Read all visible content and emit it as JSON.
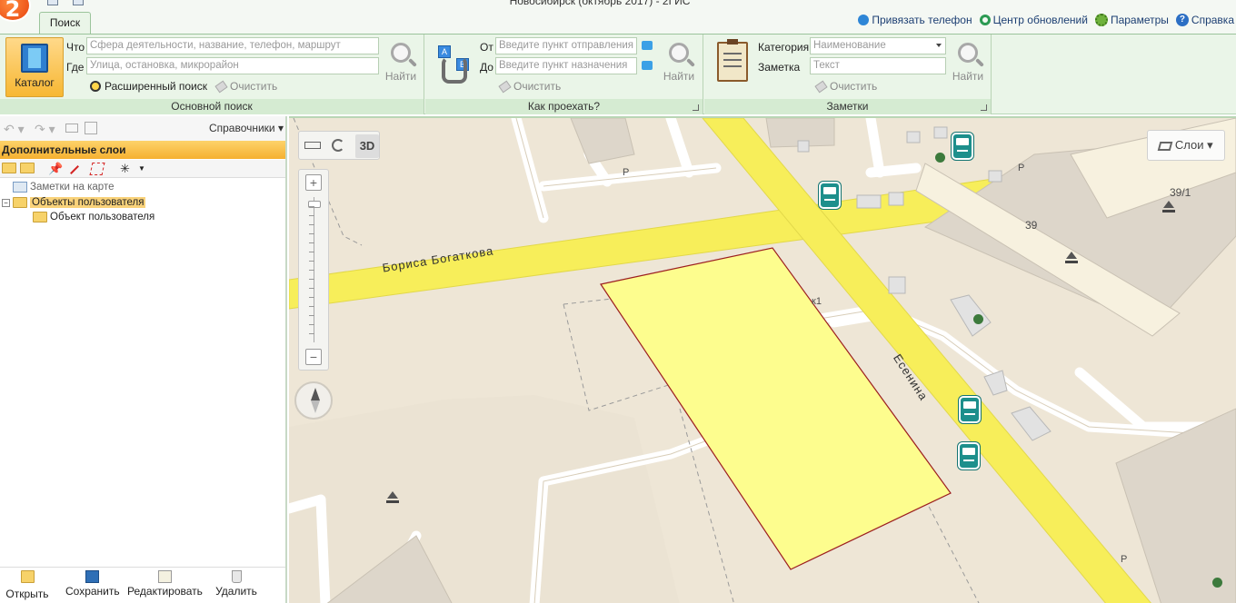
{
  "window": {
    "title": "Новосибирск (октябрь 2017) - 2ГИС",
    "logo_text": "2"
  },
  "tabs": [
    {
      "label": "Поиск"
    }
  ],
  "top_links": [
    {
      "label": "Привязать телефон",
      "icon": "phone-icon"
    },
    {
      "label": "Центр обновлений",
      "icon": "refresh-icon"
    },
    {
      "label": "Параметры",
      "icon": "gear-icon"
    },
    {
      "label": "Справка",
      "icon": "help-icon"
    }
  ],
  "ribbon": {
    "main_search": {
      "catalog_label": "Каталог",
      "what_label": "Что",
      "what_placeholder": "Сфера деятельности, название, телефон, маршрут",
      "where_label": "Где",
      "where_placeholder": "Улица, остановка, микрорайон",
      "search_label": "Найти",
      "advanced_label": "Расширенный поиск",
      "clear_label": "Очистить",
      "group_label": "Основной поиск"
    },
    "route": {
      "from_label": "От",
      "from_placeholder": "Введите пункт отправления",
      "to_label": "До",
      "to_placeholder": "Введите пункт назначения",
      "search_label": "Найти",
      "clear_label": "Очистить",
      "group_label": "Как проехать?"
    },
    "notes": {
      "category_label": "Категория",
      "category_placeholder": "Наименование",
      "note_label": "Заметка",
      "note_placeholder": "Текст",
      "search_label": "Найти",
      "clear_label": "Очистить",
      "group_label": "Заметки"
    }
  },
  "left_panel": {
    "references_label": "Справочники",
    "title": "Дополнительные слои",
    "tree": [
      {
        "label": "Заметки на карте",
        "level": 0
      },
      {
        "label": "Объекты пользователя",
        "level": 0,
        "selected": true
      },
      {
        "label": "Объект пользователя",
        "level": 1
      }
    ],
    "bottom_buttons": [
      {
        "label": "Открыть"
      },
      {
        "label": "Сохранить"
      },
      {
        "label": "Редактировать"
      },
      {
        "label": "Удалить"
      }
    ]
  },
  "map": {
    "btn_3d": "3D",
    "layers_label": "Слои",
    "streets": {
      "bogatkova": "Бориса Богаткова",
      "esenina": "Есенина"
    },
    "labels": {
      "p1": "Р",
      "p2": "Р",
      "p3": "Р",
      "house_39_1": "39/1",
      "house_39": "39",
      "k1": "к1"
    },
    "colors": {
      "road": "#f7ee5a",
      "road_border": "#e2d84a",
      "ground": "#eee6d6",
      "polygon": "#fdfd8e",
      "polygon_border": "#9c1f1f",
      "bus": "#1d8f8c"
    }
  }
}
